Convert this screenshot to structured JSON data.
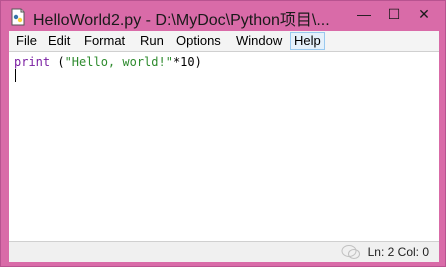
{
  "window": {
    "title": "HelloWorld2.py - D:\\MyDoc\\Python项目\\...",
    "controls": {
      "minimize": "—",
      "maximize": "☐",
      "close": "✕"
    }
  },
  "menu": {
    "items": [
      "File",
      "Edit",
      "Format",
      "Run",
      "Options",
      "Window",
      "Help"
    ],
    "active": "Help"
  },
  "editor": {
    "code": {
      "keyword": "print",
      "open": " (",
      "string": "\"Hello, world!\"",
      "rest": "*10)"
    }
  },
  "status": {
    "position": "Ln: 2  Col: 0"
  },
  "icons": {
    "app": "idle-python-icon",
    "watermark": "wechat-logo-icon"
  }
}
